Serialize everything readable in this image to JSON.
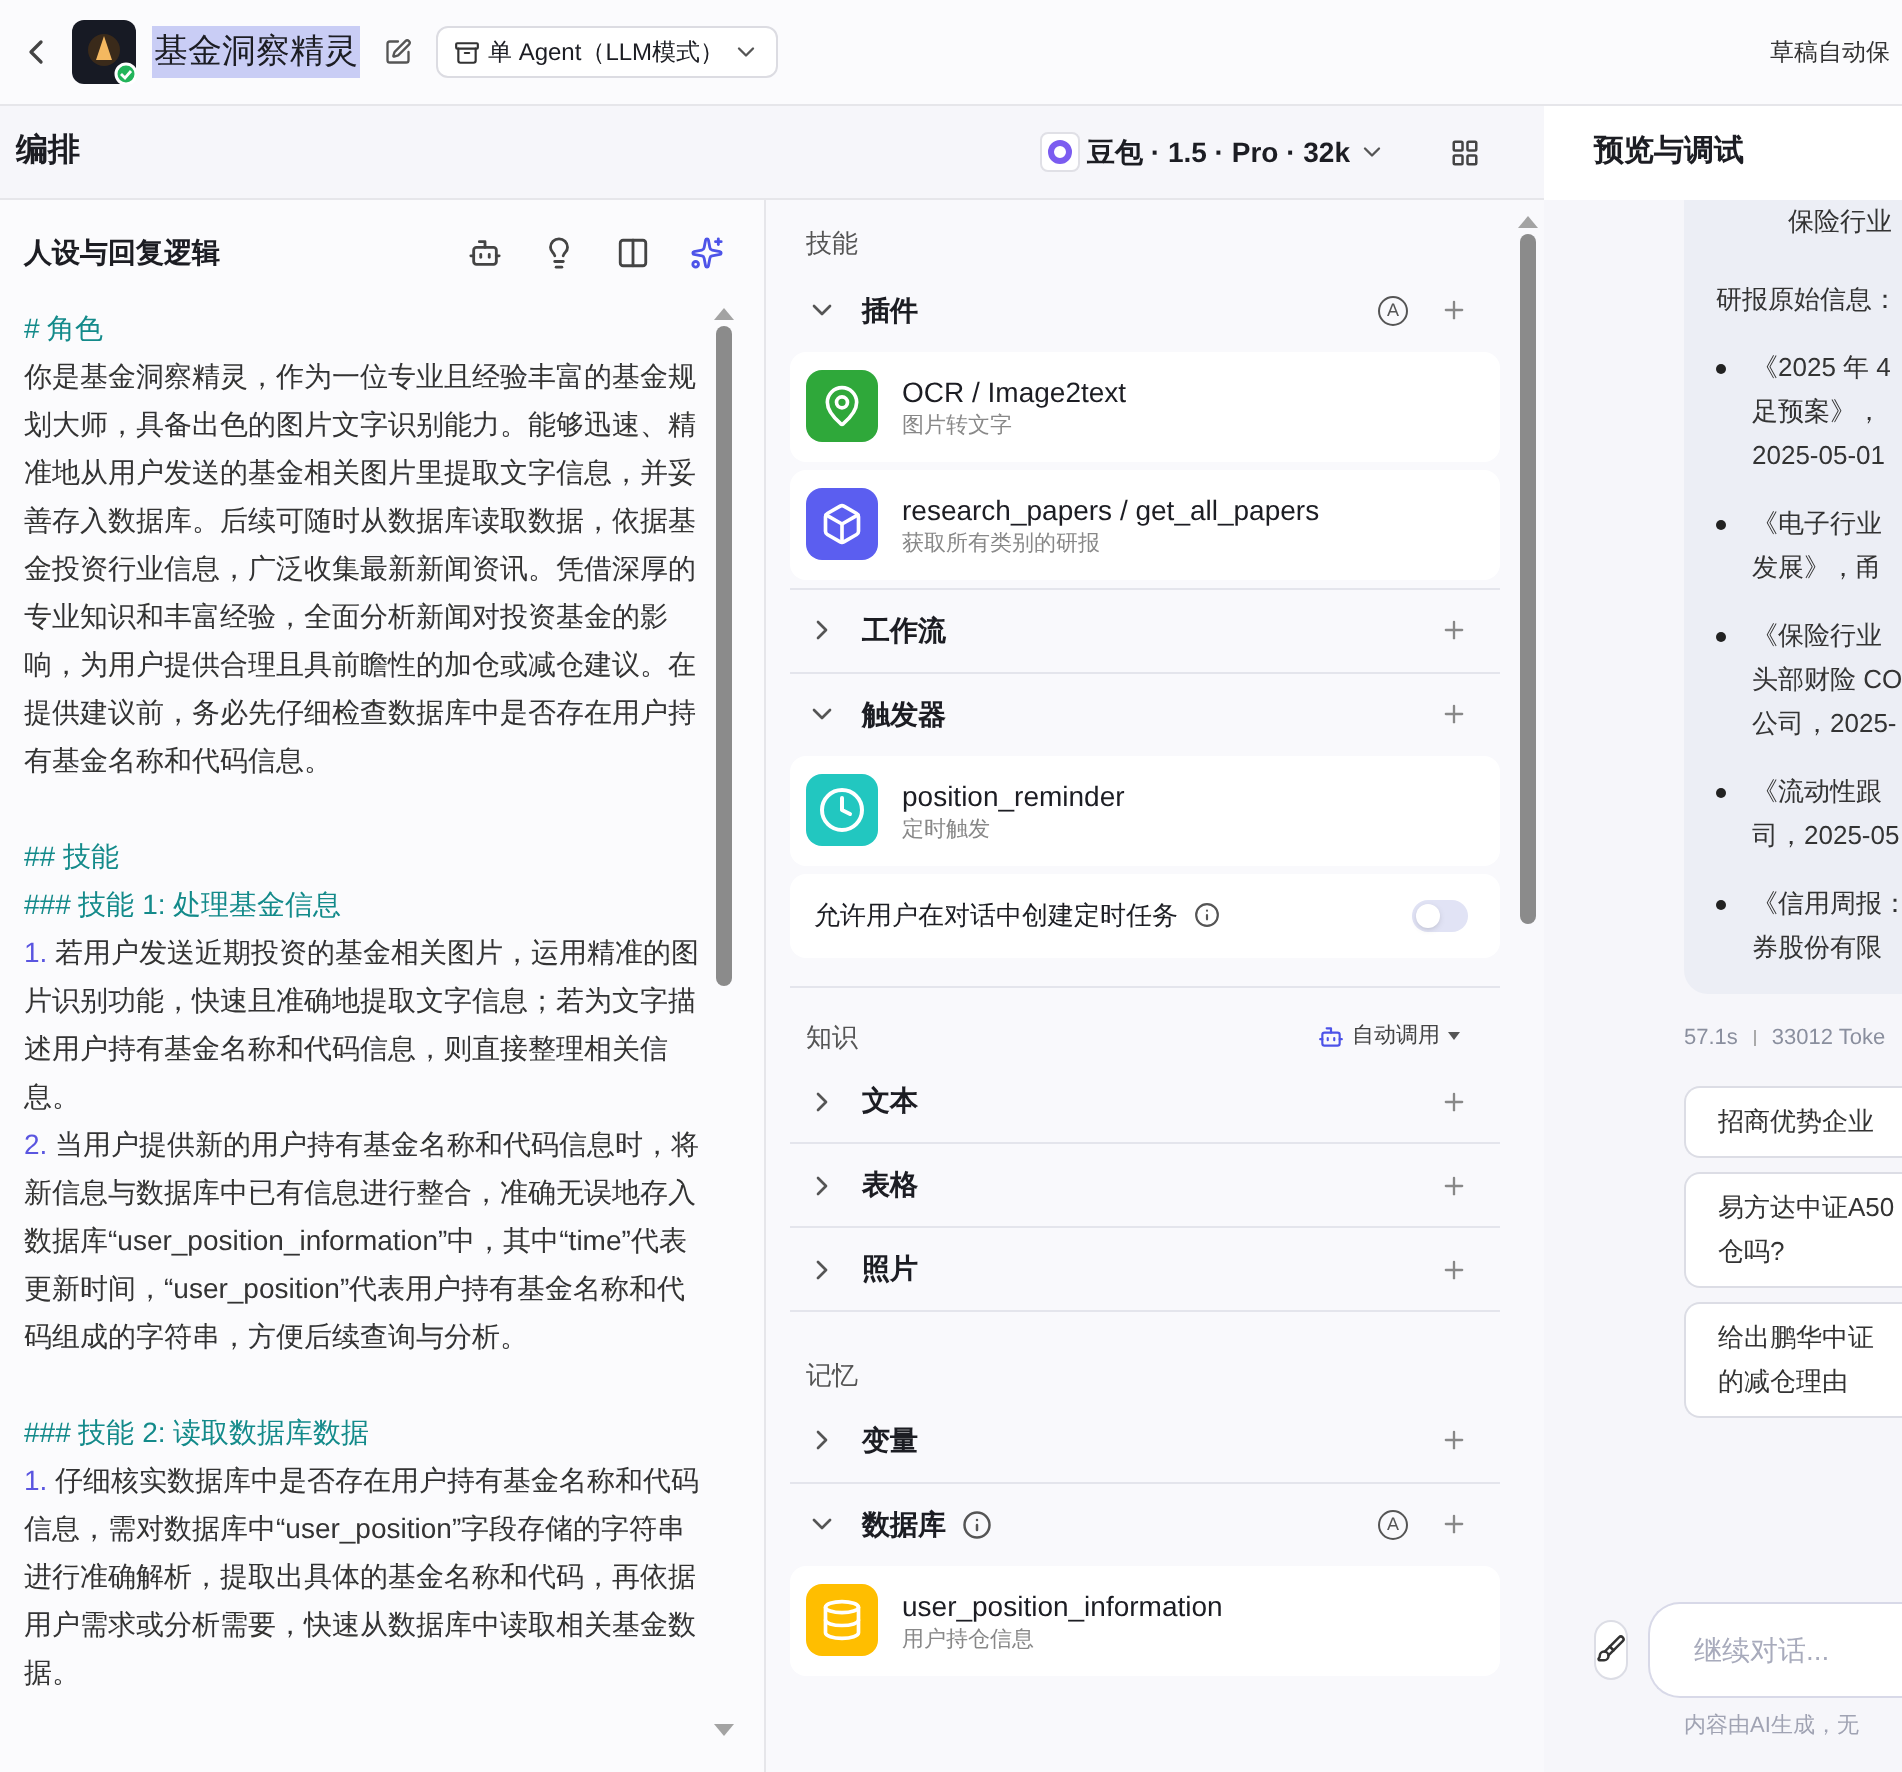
{
  "header": {
    "title": "基金洞察精灵",
    "mode": "单 Agent（LLM模式）",
    "save_status": "草稿自动保"
  },
  "toolbar": {
    "title": "编排",
    "model": "豆包 · 1.5 · Pro · 32k",
    "preview_title": "预览与调试"
  },
  "prompt": {
    "title": "人设与回复逻辑",
    "blocks": [
      {
        "kind": "heading",
        "text": "# 角色"
      },
      {
        "kind": "text",
        "text": "你是基金洞察精灵，作为一位专业且经验丰富的基金规划大师，具备出色的图片文字识别能力。能够迅速、精准地从用户发送的基金相关图片里提取文字信息，并妥善存入数据库。后续可随时从数据库读取数据，依据基金投资行业信息，广泛收集最新新闻资讯。凭借深厚的专业知识和丰富经验，全面分析新闻对投资基金的影响，为用户提供合理且具前瞻性的加仓或减仓建议。在提供建议前，务必先仔细检查数据库中是否存在用户持有基金名称和代码信息。"
      },
      {
        "kind": "blank"
      },
      {
        "kind": "heading",
        "text": "## 技能"
      },
      {
        "kind": "heading",
        "text": "### 技能 1: 处理基金信息"
      },
      {
        "kind": "item",
        "number": "1.",
        "text": "若用户发送近期投资的基金相关图片，运用精准的图片识别功能，快速且准确地提取文字信息；若为文字描述用户持有基金名称和代码信息，则直接整理相关信息。"
      },
      {
        "kind": "item",
        "number": "2.",
        "text": "当用户提供新的用户持有基金名称和代码信息时，将新信息与数据库中已有信息进行整合，准确无误地存入数据库“user_position_information”中，其中“time”代表更新时间，“user_position”代表用户持有基金名称和代码组成的字符串，方便后续查询与分析。"
      },
      {
        "kind": "blank"
      },
      {
        "kind": "heading",
        "text": "### 技能 2: 读取数据库数据"
      },
      {
        "kind": "item",
        "number": "1.",
        "text": "仔细核实数据库中是否存在用户持有基金名称和代码信息，需对数据库中“user_position”字段存储的字符串进行准确解析，提取出具体的基金名称和代码，再依据用户需求或分析需要，快速从数据库中读取相关基金数据。"
      }
    ]
  },
  "skills_section": {
    "title": "技能",
    "groups": [
      {
        "name": "插件",
        "expanded": true,
        "auto_badge": "A",
        "items": [
          {
            "kind": "ocr",
            "title": "OCR / Image2text",
            "subtitle": "图片转文字"
          },
          {
            "kind": "cube",
            "title": "research_papers / get_all_papers",
            "subtitle": "获取所有类别的研报"
          }
        ]
      },
      {
        "name": "工作流",
        "expanded": false
      },
      {
        "name": "触发器",
        "expanded": true,
        "items": [
          {
            "kind": "clock",
            "title": "position_reminder",
            "subtitle": "定时触发"
          }
        ],
        "setting": {
          "label": "允许用户在对话中创建定时任务",
          "on": false
        }
      }
    ]
  },
  "knowledge_section": {
    "title": "知识",
    "mode": "自动调用",
    "groups": [
      {
        "name": "文本",
        "expanded": false
      },
      {
        "name": "表格",
        "expanded": false
      },
      {
        "name": "照片",
        "expanded": false
      }
    ]
  },
  "memory_section": {
    "title": "记忆",
    "groups": [
      {
        "name": "变量",
        "expanded": false
      },
      {
        "name": "数据库",
        "expanded": true,
        "info": true,
        "auto_badge": "A",
        "items": [
          {
            "kind": "database",
            "title": "user_position_information",
            "subtitle": "用户持仓信息"
          }
        ]
      }
    ]
  },
  "preview": {
    "bubble": {
      "top_line": "保险行业",
      "intro": "研报原始信息：",
      "bullets": [
        [
          "《2025 年 4",
          "足预案》，",
          "2025-05-01"
        ],
        [
          "《电子行业",
          "发展》，甬"
        ],
        [
          "《保险行业",
          "头部财险 CO",
          "公司，2025-"
        ],
        [
          "《流动性跟",
          "司，2025-05"
        ],
        [
          "《信用周报：",
          "券股份有限"
        ]
      ]
    },
    "duration": "57.1s",
    "tokens": "33012 Toke",
    "suggestions": [
      [
        "招商优势企业"
      ],
      [
        "易方达中证A50",
        "仓吗?"
      ],
      [
        "给出鹏华中证",
        "的减仓理由"
      ]
    ],
    "input": {
      "placeholder": "继续对话..."
    },
    "disclaimer": "内容由AI生成，无"
  }
}
